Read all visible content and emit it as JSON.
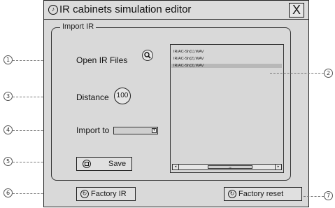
{
  "window": {
    "title": "IR cabinets simulation editor",
    "close_label": "X"
  },
  "group": {
    "legend": "Import IR"
  },
  "controls": {
    "open_ir_label": "Open IR Files",
    "distance_label": "Distance",
    "distance_value": "100",
    "import_to_label": "Import to",
    "save_label": "Save"
  },
  "files": [
    "IR/AC-Sh(1).WAV",
    "IR/AC-Sh(2).WAV",
    "IR/AC-Sh(3).WAV"
  ],
  "selected_file_index": 2,
  "scroll_thumb_label": "III",
  "bottom": {
    "factory_ir_label": "Factory IR",
    "factory_reset_label": "Factory reset"
  },
  "callouts": {
    "c1": "1",
    "c2": "2",
    "c3": "3",
    "c4": "4",
    "c5": "5",
    "c6": "6",
    "c7": "7"
  },
  "icons": {
    "app": "music-note-icon",
    "search": "search-icon",
    "save": "save-icon",
    "factory": "refresh-icon"
  }
}
